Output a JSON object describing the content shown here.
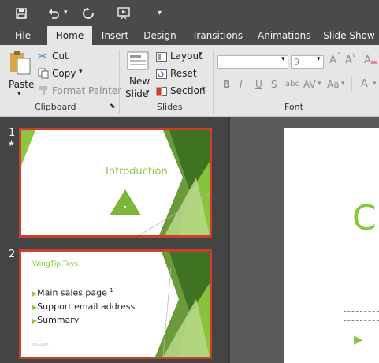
{
  "qat": {
    "save_icon": "save-icon",
    "undo_icon": "undo-icon",
    "redo_icon": "redo-icon",
    "present_icon": "present-from-beginning-icon",
    "customize_icon": "customize-qat-icon"
  },
  "tabs": [
    "File",
    "Home",
    "Insert",
    "Design",
    "Transitions",
    "Animations",
    "Slide Show"
  ],
  "ribbon": {
    "clipboard": {
      "paste": "Paste",
      "cut": "Cut",
      "copy": "Copy",
      "format_painter": "Format Painter",
      "group_label": "Clipboard"
    },
    "slides": {
      "new_slide_line1": "New",
      "new_slide_line2": "Slide",
      "layout": "Layout",
      "reset": "Reset",
      "section": "Section",
      "group_label": "Slides"
    },
    "font": {
      "font_name": "",
      "font_size": "9+",
      "bold": "B",
      "italic": "I",
      "underline": "U",
      "shadow": "S",
      "strikethrough": "abc",
      "spacing": "AV",
      "change_case": "Aa",
      "grow": "A",
      "shrink": "A",
      "clear": "A",
      "color": "A",
      "group_label": "Font"
    }
  },
  "slides": [
    {
      "number": "1",
      "marker": "★",
      "title": "Introduction",
      "footer_text": ""
    },
    {
      "number": "2",
      "title": "WingTip Toys",
      "bullets": [
        "Main sales page",
        "Support email address",
        "Summary"
      ],
      "superscript": "1",
      "footer": "5-Tor-FY05"
    }
  ],
  "editor": {
    "title_initial": "C",
    "bullet_glyph": "▶"
  },
  "colors": {
    "accent_green": "#8dc63f",
    "dark_green": "#3c6f1f",
    "selection_red": "#c9402b",
    "ribbon_bg": "#e6e6e6",
    "chrome": "#4a4a4a"
  }
}
